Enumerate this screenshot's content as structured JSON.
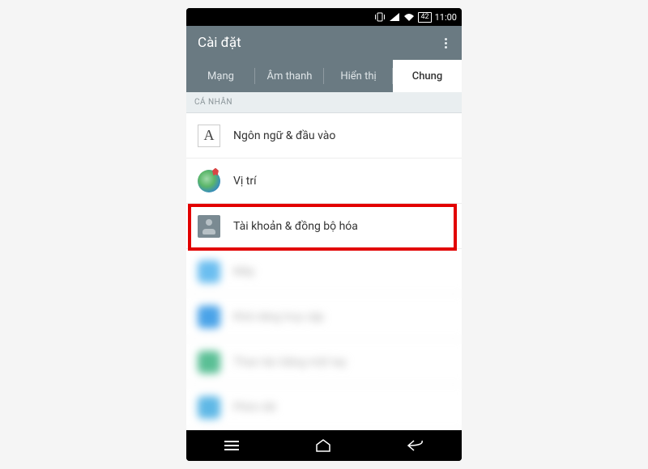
{
  "status": {
    "battery_pct": "42",
    "time": "11:00"
  },
  "appbar": {
    "title": "Cài đặt"
  },
  "tabs": [
    {
      "label": "Mạng",
      "active": false
    },
    {
      "label": "Âm thanh",
      "active": false
    },
    {
      "label": "Hiển thị",
      "active": false
    },
    {
      "label": "Chung",
      "active": true
    }
  ],
  "section": {
    "personal": "CÁ NHÂN"
  },
  "items": {
    "language": "Ngôn ngữ & đầu vào",
    "location": "Vị trí",
    "accounts": "Tài khoản & đồng bộ hóa"
  },
  "blurred": [
    {
      "color": "#6bbef0",
      "text": "Mây"
    },
    {
      "color": "#4aa3e8",
      "text": "Khả năng truy cập"
    },
    {
      "color": "#5abf95",
      "text": "Thao tác bằng một tay"
    },
    {
      "color": "#5fb8e6",
      "text": "Phím tắt"
    }
  ],
  "highlight_index": 2
}
